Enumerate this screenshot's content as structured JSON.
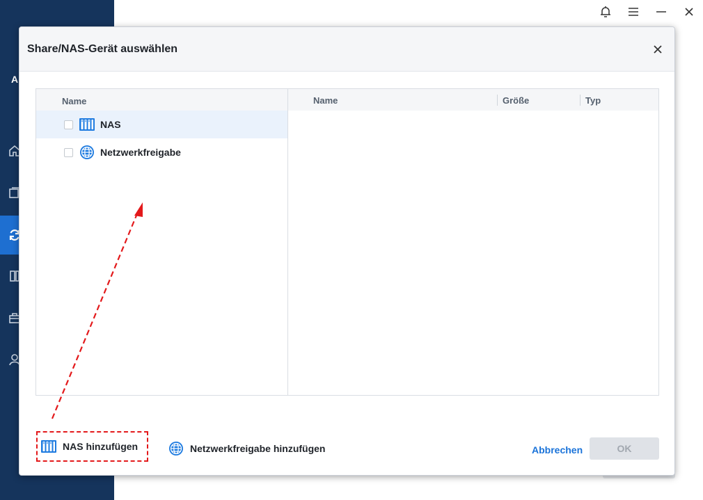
{
  "app": {
    "brand_letter": "A",
    "topbar_icons": [
      "bell-icon",
      "menu-icon",
      "minimize-icon",
      "close-icon"
    ],
    "nav_icons": [
      "home-icon",
      "backup-icon",
      "sync-icon",
      "clone-icon",
      "tools-icon",
      "account-icon"
    ],
    "accent": "#1e6fd1",
    "sidebar_bg": "#15345c"
  },
  "dialog": {
    "title": "Share/NAS-Gerät auswählen",
    "left_pane": {
      "header": "Name",
      "items": [
        {
          "label": "NAS",
          "icon": "nas-icon",
          "selected": true
        },
        {
          "label": "Netzwerkfreigabe",
          "icon": "globe-icon",
          "selected": false
        }
      ]
    },
    "right_pane": {
      "columns": [
        "Name",
        "Größe",
        "Typ"
      ]
    },
    "footer": {
      "add_nas": "NAS hinzufügen",
      "add_share": "Netzwerkfreigabe hinzufügen",
      "cancel": "Abbrechen",
      "ok": "OK"
    },
    "annotation_color": "#e3191b"
  }
}
